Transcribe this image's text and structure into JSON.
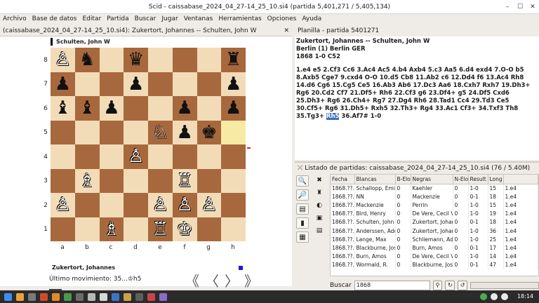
{
  "window": {
    "title": "Scid - caissabase_2024_04_27-14_25_10.si4 (partida 5,401,271 / 5,405,134)"
  },
  "menu": [
    "Archivo",
    "Base de datos",
    "Editar",
    "Partida",
    "Buscar",
    "Jugar",
    "Ventanas",
    "Herramientas",
    "Opciones",
    "Ayuda"
  ],
  "board_panel": {
    "title": "(caissabase_2024_04_27-14_25_10.si4): Zukertort, Johannes -- Schulten, John W",
    "black_player": "Schulten, John W",
    "white_player": "Zukertort, Johannes",
    "last_move": "Último movimiento: 35...♔h5",
    "ranks": [
      "8",
      "7",
      "6",
      "5",
      "4",
      "3",
      "2",
      "1"
    ],
    "files": [
      "a",
      "b",
      "c",
      "d",
      "e",
      "f",
      "g",
      "h"
    ]
  },
  "pieces": [
    [
      "♙",
      "♞",
      "",
      "♛",
      "",
      "",
      "",
      "♜"
    ],
    [
      "♟",
      "",
      "",
      "♟",
      "",
      "",
      "",
      "♟"
    ],
    [
      "♝",
      "♝",
      "♟",
      "",
      "",
      "♟",
      "",
      "♟"
    ],
    [
      "",
      "",
      "",
      "",
      "♘",
      "♟",
      "♚",
      ""
    ],
    [
      "",
      "",
      "",
      "♙",
      "",
      "",
      "",
      ""
    ],
    [
      "",
      "♗",
      "",
      "",
      "",
      "♖",
      "",
      ""
    ],
    [
      "♙",
      "",
      "",
      "",
      "♙",
      "♙",
      "♙",
      ""
    ],
    [
      "",
      "",
      "♗",
      "",
      "♖",
      "♔",
      "",
      ""
    ]
  ],
  "colors": [
    [
      "w",
      "b",
      "",
      "b",
      "",
      "",
      "",
      "b"
    ],
    [
      "b",
      "",
      "",
      "b",
      "",
      "",
      "",
      "b"
    ],
    [
      "b",
      "b",
      "b",
      "",
      "",
      "b",
      "",
      "b"
    ],
    [
      "",
      "",
      "",
      "",
      "w",
      "b",
      "b",
      ""
    ],
    [
      "",
      "",
      "",
      "w",
      "",
      "",
      "",
      ""
    ],
    [
      "",
      "w",
      "",
      "",
      "",
      "w",
      "",
      ""
    ],
    [
      "w",
      "",
      "",
      "",
      "w",
      "w",
      "w",
      ""
    ],
    [
      "",
      "",
      "w",
      "",
      "w",
      "w",
      "",
      ""
    ]
  ],
  "planilla": {
    "title": "Planilla - partida 5401271",
    "header": "Zukertort, Johannes   --   Schulten, John W",
    "event": "Berlin (1)  Berlin GER",
    "result": "1868  1-0  C52",
    "moves": "1.e4 e5 2.Cf3 Cc6 3.Ac4 Ac5 4.b4 Axb4 5.c3 Aa5 6.d4 exd4 7.O-O b5 8.Axb5 Cge7 9.cxd4 O-O 10.d5 Cb8 11.Ab2 c6 12.Dd4 f6 13.Ac4 Rh8 14.d6 Cg6 15.Cg5 Ce5 16.Ab3 Ab6 17.Dc3 Aa6 18.Cxh7 Rxh7 19.Dh3+ Rg6 20.Cd2 Cf7 21.Df5+ Rh6 22.Cf3 g6 23.Df4+ g5 24.Df5 Cxd6 25.Dh3+ Rg6 26.Ch4+ Rg7 27.Dg4 Rh6 28.Tad1 Cc4 29.Td3 Ce5 30.Cf5+ Rg6 31.Dh5+ Rxh5 32.Th3+ Rg4 33.Ac1 Cf3+ 34.Txf3 Th8 35.Tg3+",
    "current": "Rh5",
    "after": " 36.Af7# 1-0"
  },
  "gamelist": {
    "title": "Listado de partidas: caissabase_2024_04_27-14_25_10.si4 (76 / 5.40M)",
    "columns": [
      "Fecha",
      "Blancas",
      "B-Elo",
      "Negras",
      "N-Elo",
      "Result",
      "Long"
    ],
    "rows": [
      [
        "1868.??.??",
        "Schallopp, Emil",
        "0",
        "Kaehler",
        "0",
        "1-0",
        "15",
        "1.e4"
      ],
      [
        "1868.??.??",
        "NN",
        "0",
        "Mackenzie",
        "0",
        "0-1",
        "18",
        "1.e4"
      ],
      [
        "1868.??.??",
        "Mackenzie",
        "0",
        "Perrin",
        "0",
        "1-0",
        "15",
        "1.e4"
      ],
      [
        "1868.??.??",
        "Bird, Henry",
        "0",
        "De Vere, Cecil V",
        "0",
        "1-0",
        "19",
        "1.e4"
      ],
      [
        "1868.??.??",
        "Schulten, John W",
        "0",
        "Zukertort, Johanne",
        "0",
        "0-1",
        "18",
        "1.e4"
      ],
      [
        "1868.??.??",
        "Anderssen, Adolf",
        "0",
        "Zukertort, Johanne",
        "0",
        "1-0",
        "36",
        "1.e4"
      ],
      [
        "1868.??.??",
        "Lange, Max",
        "0",
        "Schliemann, Adolp",
        "0",
        "1-0",
        "25",
        "1.e4"
      ],
      [
        "1868.??.??",
        "Blackburne, Joseph",
        "0",
        "Burn, Amos",
        "0",
        "0-1",
        "17",
        "1.e4"
      ],
      [
        "1868.??.??",
        "Burn, Amos",
        "0",
        "De Vere, Cecil V",
        "0",
        "1-0",
        "14",
        "1.e4"
      ],
      [
        "1868.??.??",
        "Wormald, R.",
        "0",
        "Blackburne, Joseph",
        "0",
        "0-1",
        "47",
        "1.e4"
      ]
    ]
  },
  "search": {
    "label": "Buscar",
    "value": "1868"
  },
  "clock": "18:14",
  "accent": "#3d6fb5"
}
